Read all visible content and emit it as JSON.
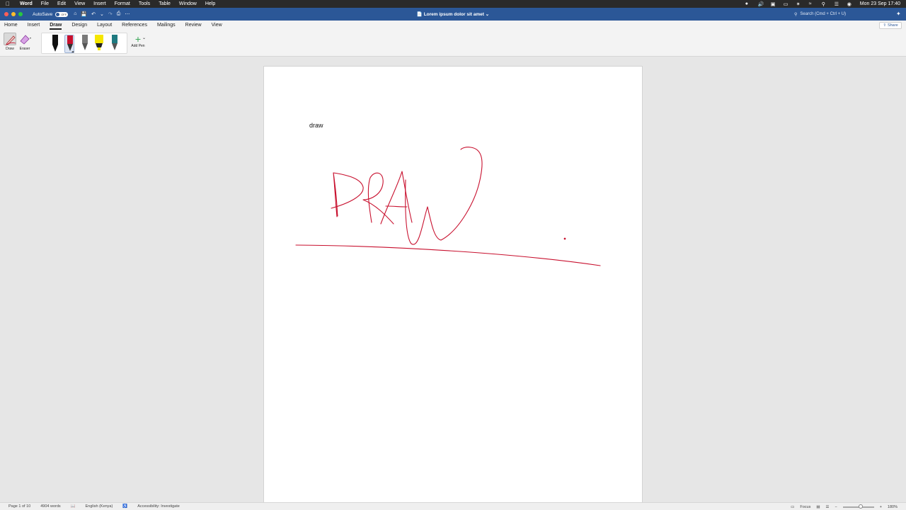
{
  "menubar": {
    "app": "Word",
    "items": [
      "File",
      "Edit",
      "View",
      "Insert",
      "Format",
      "Tools",
      "Table",
      "Window",
      "Help"
    ],
    "datetime": "Mon 23 Sep  17:40"
  },
  "titlebar": {
    "autosave_label": "AutoSave",
    "autosave_state": "OFF",
    "document_title": "Lorem ipsum dolor sit amet",
    "search_placeholder": "Search (Cmd + Ctrl + U)"
  },
  "tabs": [
    "Home",
    "Insert",
    "Draw",
    "Design",
    "Layout",
    "References",
    "Mailings",
    "Review",
    "View"
  ],
  "active_tab": "Draw",
  "share_label": "Share",
  "ribbon": {
    "draw_label": "Draw",
    "eraser_label": "Eraser",
    "add_pen_label": "Add Pen",
    "pens": [
      {
        "name": "black-pen",
        "color": "#111111"
      },
      {
        "name": "red-pen",
        "color": "#c8102e",
        "selected": true
      },
      {
        "name": "grey-pencil",
        "color": "#7a7a7a"
      },
      {
        "name": "yellow-highlighter",
        "color": "#f5e600"
      },
      {
        "name": "teal-pen",
        "color": "#1f7a80"
      }
    ]
  },
  "document": {
    "body_text": "draw",
    "ink_color": "#c8102e"
  },
  "statusbar": {
    "page": "Page 1 of 10",
    "words": "4904 words",
    "language": "English (Kenya)",
    "accessibility": "Accessibility: Investigate",
    "focus": "Focus",
    "zoom": "180%",
    "zoom_level": 0.58
  }
}
